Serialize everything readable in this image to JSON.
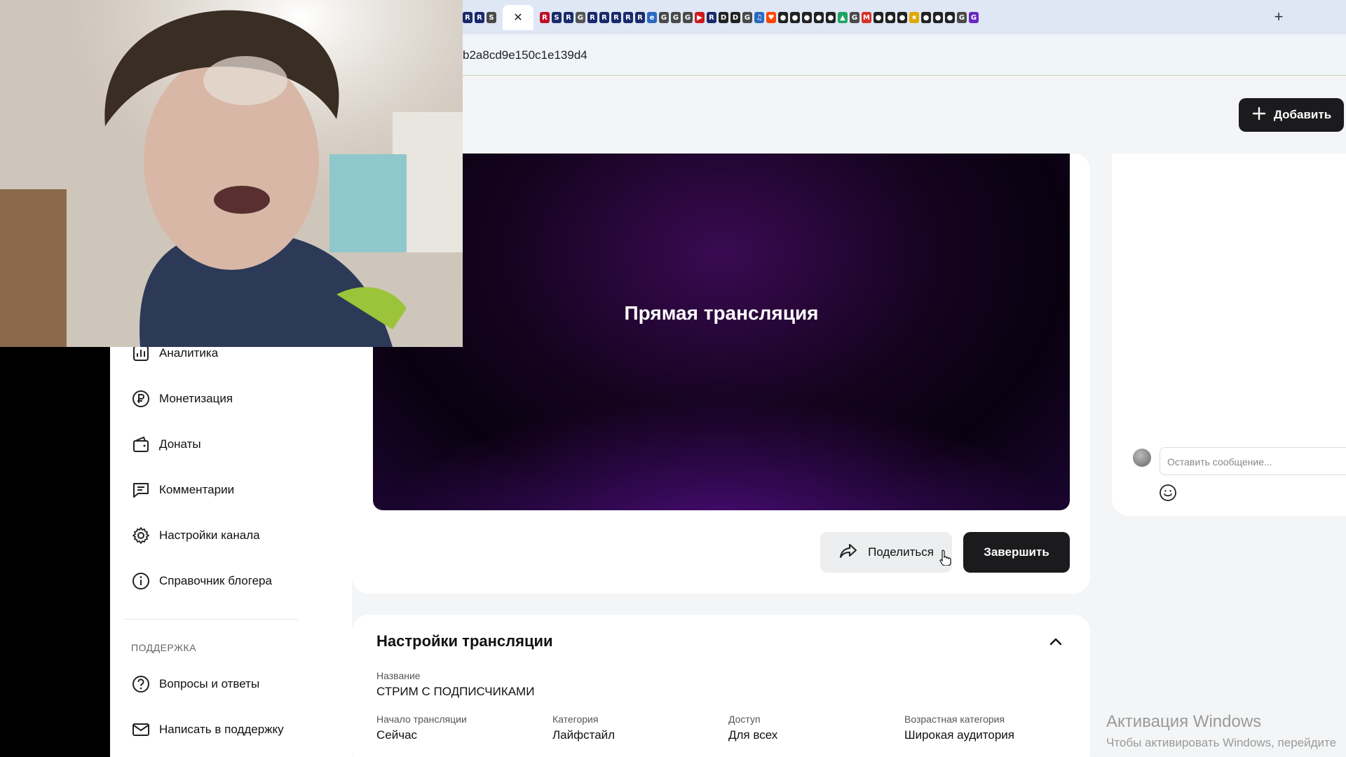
{
  "browser": {
    "active_tab_close": "✕",
    "new_tab": "+",
    "url_fragment": "b2a8cd9e150c1e139d4",
    "tab_favicons": [
      {
        "label": "R",
        "color": "#1a2a6c"
      },
      {
        "label": "R",
        "color": "#1a2a6c"
      },
      {
        "label": "S",
        "color": "#4a4a4a"
      },
      {
        "label": "R",
        "color": "#c0102a"
      },
      {
        "label": "S",
        "color": "#1a2a6c"
      },
      {
        "label": "R",
        "color": "#1a2a6c"
      },
      {
        "label": "G",
        "color": "#555"
      },
      {
        "label": "R",
        "color": "#1a2a6c"
      },
      {
        "label": "R",
        "color": "#1a2a6c"
      },
      {
        "label": "R",
        "color": "#1a2a6c"
      },
      {
        "label": "R",
        "color": "#1a2a6c"
      },
      {
        "label": "R",
        "color": "#1a2a6c"
      },
      {
        "label": "e",
        "color": "#2a6ac0"
      },
      {
        "label": "G",
        "color": "#4a4a4a"
      },
      {
        "label": "G",
        "color": "#4a4a4a"
      },
      {
        "label": "G",
        "color": "#4a4a4a"
      },
      {
        "label": "▶",
        "color": "#d01a1a"
      },
      {
        "label": "R",
        "color": "#1a2a6c"
      },
      {
        "label": "D",
        "color": "#222"
      },
      {
        "label": "D",
        "color": "#222"
      },
      {
        "label": "G",
        "color": "#4a4a4a"
      },
      {
        "label": "♫",
        "color": "#2a6ac0"
      },
      {
        "label": "♥",
        "color": "#ff4500"
      },
      {
        "label": "●",
        "color": "#222"
      },
      {
        "label": "●",
        "color": "#222"
      },
      {
        "label": "●",
        "color": "#222"
      },
      {
        "label": "●",
        "color": "#222"
      },
      {
        "label": "●",
        "color": "#222"
      },
      {
        "label": "▲",
        "color": "#1fa463"
      },
      {
        "label": "G",
        "color": "#4a4a4a"
      },
      {
        "label": "M",
        "color": "#d93025"
      },
      {
        "label": "●",
        "color": "#222"
      },
      {
        "label": "●",
        "color": "#222"
      },
      {
        "label": "●",
        "color": "#222"
      },
      {
        "label": "★",
        "color": "#e0a800"
      },
      {
        "label": "●",
        "color": "#222"
      },
      {
        "label": "●",
        "color": "#222"
      },
      {
        "label": "●",
        "color": "#222"
      },
      {
        "label": "G",
        "color": "#4a4a4a"
      },
      {
        "label": "G",
        "color": "#6a2ac0"
      }
    ]
  },
  "header": {
    "add_label": "Добавить"
  },
  "sidebar": {
    "items": [
      {
        "label": "Аналитика",
        "icon": "chart-icon"
      },
      {
        "label": "Монетизация",
        "icon": "ruble-icon"
      },
      {
        "label": "Донаты",
        "icon": "wallet-icon"
      },
      {
        "label": "Комментарии",
        "icon": "comment-icon"
      },
      {
        "label": "Настройки канала",
        "icon": "gear-icon"
      },
      {
        "label": "Справочник блогера",
        "icon": "info-icon"
      }
    ],
    "support_title": "ПОДДЕРЖКА",
    "support_items": [
      {
        "label": "Вопросы и ответы",
        "icon": "question-icon"
      },
      {
        "label": "Написать в поддержку",
        "icon": "mail-icon"
      }
    ]
  },
  "player": {
    "title": "Прямая трансляция"
  },
  "actions": {
    "share_label": "Поделиться",
    "finish_label": "Завершить"
  },
  "chat": {
    "placeholder": "Оставить сообщение..."
  },
  "settings": {
    "title": "Настройки трансляции",
    "name_label": "Название",
    "name_value": "СТРИМ С ПОДПИСЧИКАМИ",
    "fields": [
      {
        "label": "Начало трансляции",
        "value": "Сейчас"
      },
      {
        "label": "Категория",
        "value": "Лайфстайл"
      },
      {
        "label": "Доступ",
        "value": "Для всех"
      },
      {
        "label": "Возрастная категория",
        "value": "Широкая аудитория"
      }
    ]
  },
  "watermark": {
    "title": "Активация Windows",
    "subtitle": "Чтобы активировать Windows, перейдите"
  },
  "colors": {
    "dark_button": "#1b1b1d",
    "player_purple": "#3a0a52"
  }
}
